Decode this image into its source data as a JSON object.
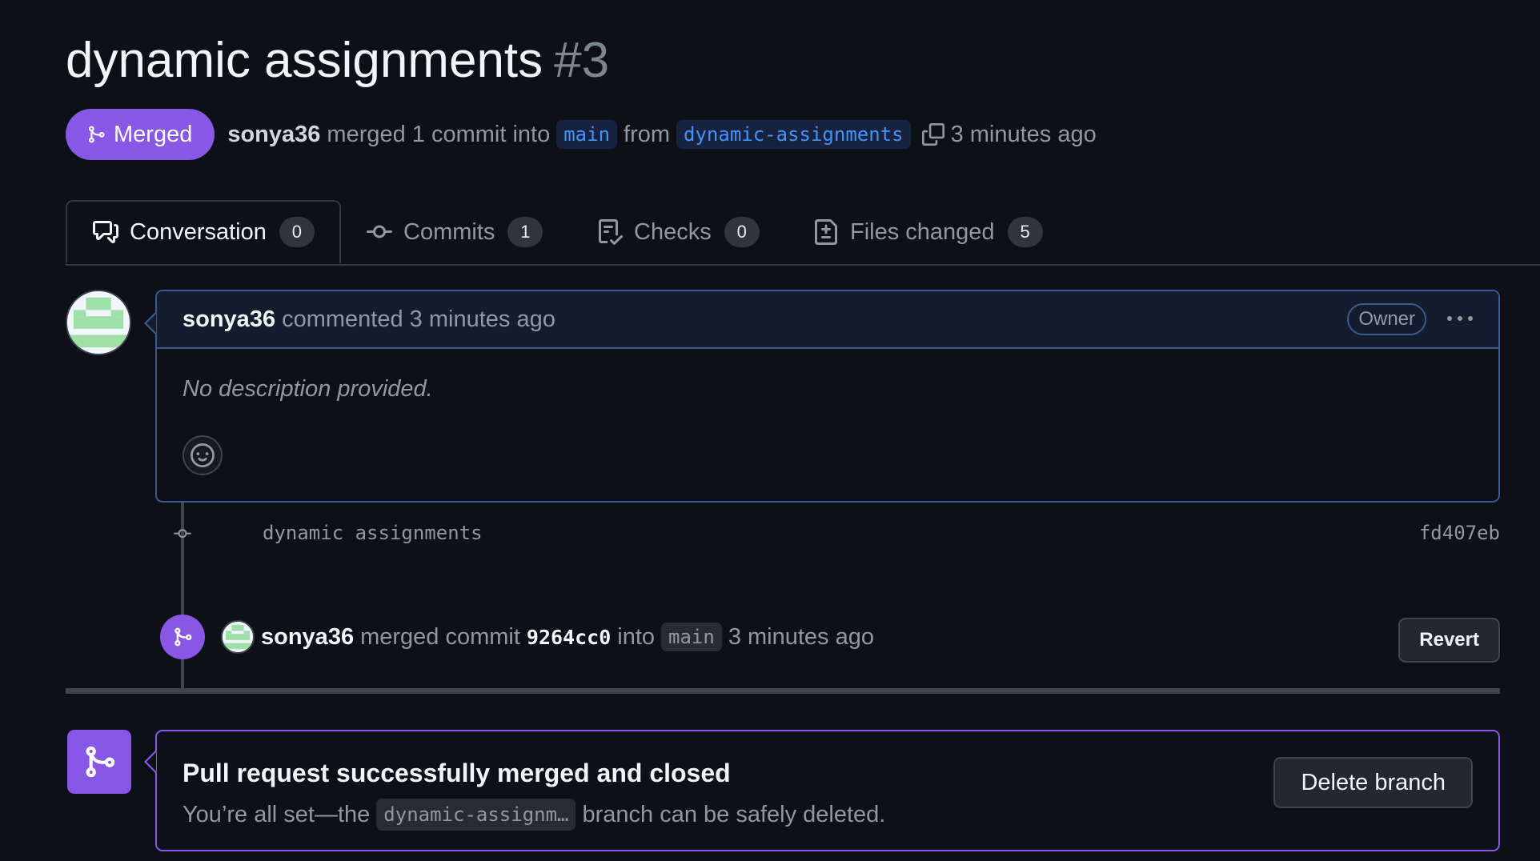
{
  "pr": {
    "title": "dynamic assignments",
    "number": "#3",
    "state": "Merged",
    "author": "sonya36",
    "summary_merged": "merged 1 commit into",
    "base_branch": "main",
    "from_text": "from",
    "head_branch": "dynamic-assignments",
    "time": "3 minutes ago"
  },
  "tabs": [
    {
      "label": "Conversation",
      "count": "0",
      "icon": "comment-discussion-icon"
    },
    {
      "label": "Commits",
      "count": "1",
      "icon": "git-commit-icon"
    },
    {
      "label": "Checks",
      "count": "0",
      "icon": "checklist-icon"
    },
    {
      "label": "Files changed",
      "count": "5",
      "icon": "file-diff-icon"
    }
  ],
  "comment": {
    "author": "sonya36",
    "action": "commented",
    "time": "3 minutes ago",
    "role": "Owner",
    "body": "No description provided.",
    "more_icon": "kebab-horizontal-icon",
    "reaction_icon": "smiley-icon"
  },
  "commit": {
    "message": "dynamic assignments",
    "sha": "fd407eb"
  },
  "merge_event": {
    "author": "sonya36",
    "text_merged": "merged commit",
    "sha": "9264cc0",
    "text_into": "into",
    "branch": "main",
    "time": "3 minutes ago",
    "revert_label": "Revert"
  },
  "merged_box": {
    "title": "Pull request successfully merged and closed",
    "desc_prefix": "You’re all set—the",
    "branch": "dynamic-assignm…",
    "desc_suffix": "branch can be safely deleted.",
    "delete_label": "Delete branch"
  },
  "colors": {
    "merged": "#8957e5",
    "link": "#4493f8",
    "background": "#0d1117"
  }
}
